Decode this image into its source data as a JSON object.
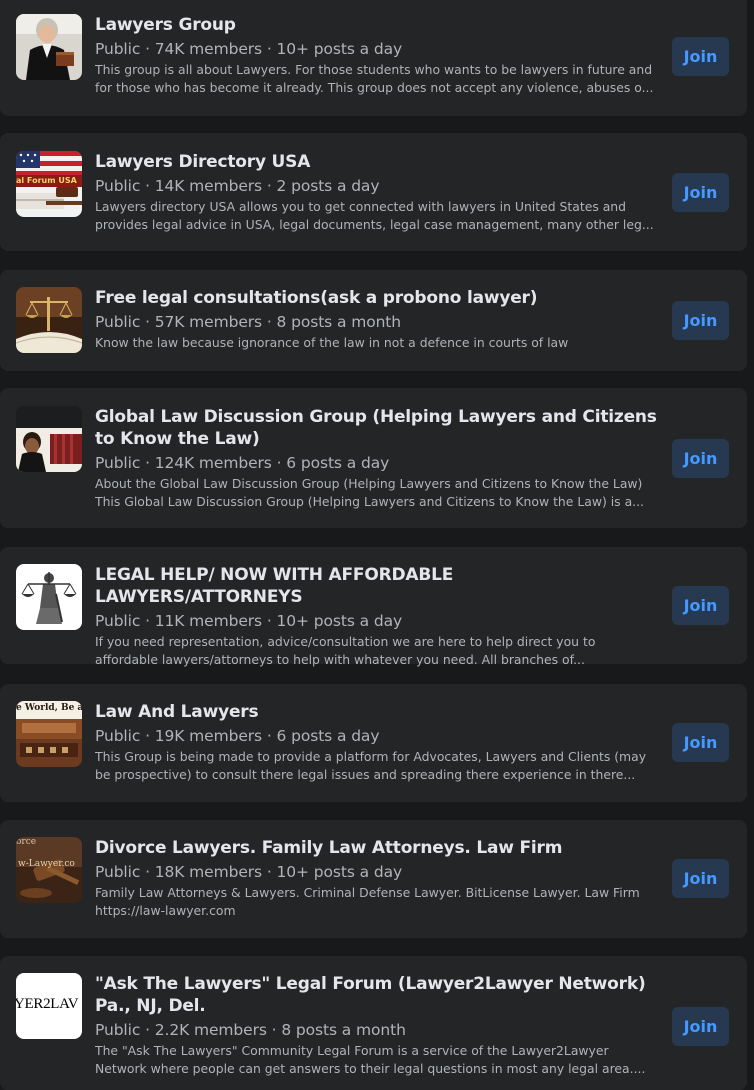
{
  "groups": [
    {
      "name": "Lawyers Group",
      "meta": "Public · 74K members · 10+ posts a day",
      "description": "This group is all about Lawyers. For those students who wants to be lawyers in future and for those who has become it already. This group does not accept any violence, abuses o...",
      "join_label": "Join",
      "thumb": "judge-in-robe-photo"
    },
    {
      "name": "Lawyers Directory USA",
      "meta": "Public · 14K members · 2 posts a day",
      "description": "Lawyers directory USA allows you to get connected with lawyers in United States and provides legal advice in USA, legal documents, legal case management, many other leg...",
      "join_label": "Join",
      "thumb": "us-flag-gavel-photo",
      "thumb_text": "al Forum USA"
    },
    {
      "name": "Free legal consultations(ask a probono lawyer)",
      "meta": "Public · 57K members · 8 posts a month",
      "description": "Know the law because ignorance of the law in not a defence in courts of law",
      "join_label": "Join",
      "thumb": "scales-and-books-photo"
    },
    {
      "name": "Global Law Discussion Group (Helping Lawyers and Citizens to Know the Law)",
      "meta": "Public · 124K members · 6 posts a day",
      "description": "About the Global Law Discussion Group (Helping Lawyers and Citizens to Know the Law) This Global Law Discussion Group (Helping Lawyers and Citizens to Know the Law) is a...",
      "join_label": "Join",
      "thumb": "lawyer-with-books-photo"
    },
    {
      "name": "LEGAL HELP/ NOW WITH AFFORDABLE LAWYERS/ATTORNEYS",
      "meta": "Public · 11K members · 10+ posts a day",
      "description": "If you need representation, advice/consultation we are here to help direct you to affordable lawyers/attorneys to help with whatever you need. All branches of...",
      "join_label": "Join",
      "thumb": "lady-justice-drawing"
    },
    {
      "name": "Law And Lawyers",
      "meta": "Public · 19K members · 6 posts a day",
      "description": "This Group is being made to provide a platform for Advocates, Lawyers and Clients (may be prospective) to consult there legal issues and spreading there experience in there...",
      "join_label": "Join",
      "thumb": "courtroom-photo",
      "thumb_text": "e World, Be a"
    },
    {
      "name": "Divorce Lawyers. Family Law Attorneys. Law Firm",
      "meta": "Public · 18K members · 10+ posts a day",
      "description": "Family Law Attorneys & Lawyers. Criminal Defense Lawyer. BitLicense Lawyer. Law Firm https://law-lawyer.com",
      "join_label": "Join",
      "thumb": "gavel-divorce-photo",
      "thumb_text": "w-Lawyer.co",
      "thumb_text_top": "orce"
    },
    {
      "name": "\"Ask The Lawyers\" Legal Forum (Lawyer2Lawyer Network) Pa., NJ, Del.",
      "meta": "Public · 2.2K members · 8 posts a month",
      "description": "The \"Ask The Lawyers\" Community Legal Forum is a service of the Lawyer2Lawyer Network where people can get answers to their legal questions in most any legal area....",
      "join_label": "Join",
      "thumb": "lawyer2lawyer-logo",
      "thumb_text": "YER2LAV"
    }
  ]
}
